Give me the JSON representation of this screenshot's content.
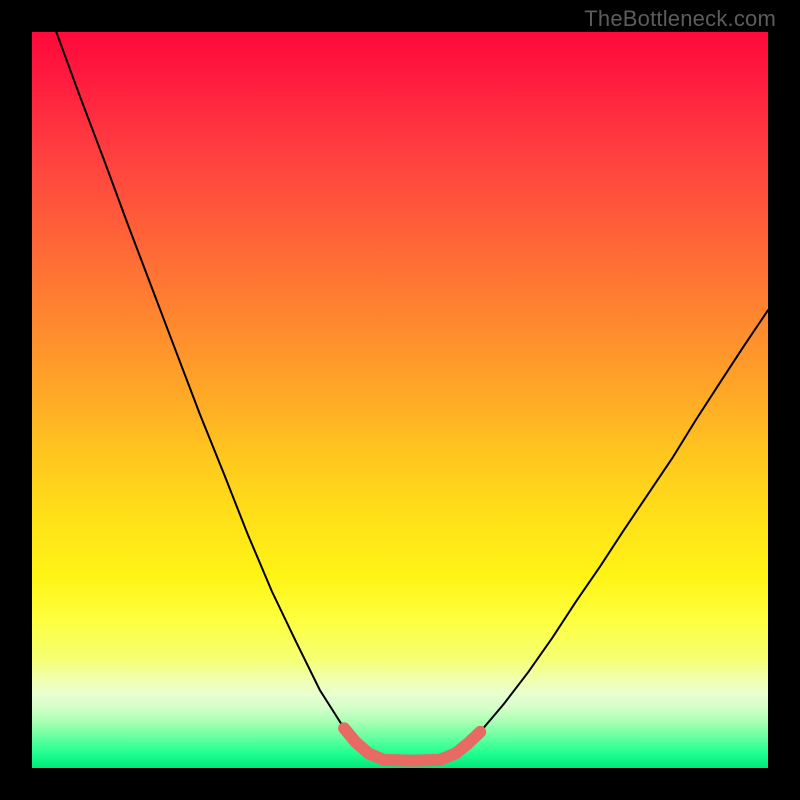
{
  "watermark": "TheBottleneck.com",
  "chart_data": {
    "type": "line",
    "title": "",
    "xlabel": "",
    "ylabel": "",
    "xlim": [
      0,
      100
    ],
    "ylim": [
      0,
      100
    ],
    "grid": false,
    "legend": false,
    "curve": [
      {
        "x": 3.3,
        "y": 100.0
      },
      {
        "x": 6.5,
        "y": 91.3
      },
      {
        "x": 9.8,
        "y": 82.6
      },
      {
        "x": 13.0,
        "y": 73.9
      },
      {
        "x": 16.3,
        "y": 65.2
      },
      {
        "x": 19.6,
        "y": 56.5
      },
      {
        "x": 22.8,
        "y": 48.1
      },
      {
        "x": 26.1,
        "y": 39.9
      },
      {
        "x": 29.3,
        "y": 31.8
      },
      {
        "x": 32.6,
        "y": 24.0
      },
      {
        "x": 35.9,
        "y": 17.1
      },
      {
        "x": 39.1,
        "y": 10.6
      },
      {
        "x": 42.4,
        "y": 5.4
      },
      {
        "x": 45.7,
        "y": 2.0
      },
      {
        "x": 47.8,
        "y": 1.1
      },
      {
        "x": 51.6,
        "y": 1.0
      },
      {
        "x": 55.4,
        "y": 1.1
      },
      {
        "x": 57.6,
        "y": 2.0
      },
      {
        "x": 60.9,
        "y": 4.9
      },
      {
        "x": 64.1,
        "y": 8.7
      },
      {
        "x": 67.4,
        "y": 13.0
      },
      {
        "x": 70.7,
        "y": 17.7
      },
      {
        "x": 73.9,
        "y": 22.6
      },
      {
        "x": 77.2,
        "y": 27.4
      },
      {
        "x": 80.4,
        "y": 32.3
      },
      {
        "x": 83.7,
        "y": 37.2
      },
      {
        "x": 87.0,
        "y": 42.1
      },
      {
        "x": 90.2,
        "y": 47.3
      },
      {
        "x": 93.5,
        "y": 52.4
      },
      {
        "x": 96.7,
        "y": 57.3
      },
      {
        "x": 100.0,
        "y": 62.2
      }
    ],
    "thick_segment": [
      {
        "x": 42.4,
        "y": 5.4
      },
      {
        "x": 44.0,
        "y": 3.5
      },
      {
        "x": 45.7,
        "y": 2.0
      },
      {
        "x": 47.8,
        "y": 1.1
      },
      {
        "x": 51.6,
        "y": 1.0
      },
      {
        "x": 55.4,
        "y": 1.1
      },
      {
        "x": 57.6,
        "y": 2.0
      },
      {
        "x": 59.2,
        "y": 3.3
      },
      {
        "x": 60.9,
        "y": 4.9
      }
    ],
    "colors": {
      "curve_stroke": "#000000",
      "thick_stroke": "#e76a63",
      "background_top": "#ff0a3a",
      "background_bottom": "#00e878"
    }
  }
}
